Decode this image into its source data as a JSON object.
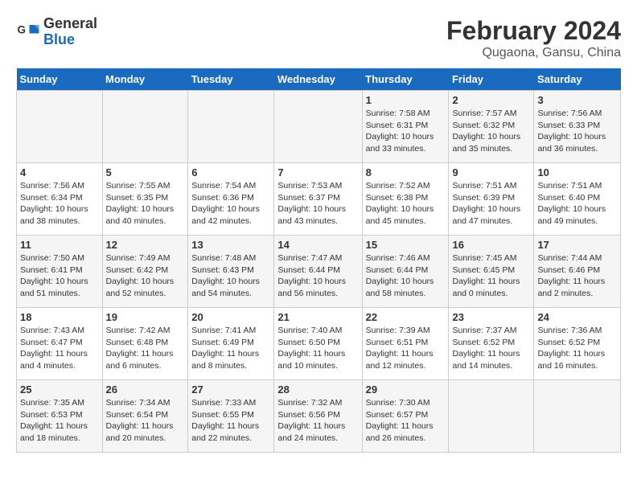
{
  "logo": {
    "text_general": "General",
    "text_blue": "Blue"
  },
  "title": "February 2024",
  "subtitle": "Qugaona, Gansu, China",
  "days_of_week": [
    "Sunday",
    "Monday",
    "Tuesday",
    "Wednesday",
    "Thursday",
    "Friday",
    "Saturday"
  ],
  "weeks": [
    [
      {
        "day": "",
        "info": ""
      },
      {
        "day": "",
        "info": ""
      },
      {
        "day": "",
        "info": ""
      },
      {
        "day": "",
        "info": ""
      },
      {
        "day": "1",
        "info": "Sunrise: 7:58 AM\nSunset: 6:31 PM\nDaylight: 10 hours\nand 33 minutes."
      },
      {
        "day": "2",
        "info": "Sunrise: 7:57 AM\nSunset: 6:32 PM\nDaylight: 10 hours\nand 35 minutes."
      },
      {
        "day": "3",
        "info": "Sunrise: 7:56 AM\nSunset: 6:33 PM\nDaylight: 10 hours\nand 36 minutes."
      }
    ],
    [
      {
        "day": "4",
        "info": "Sunrise: 7:56 AM\nSunset: 6:34 PM\nDaylight: 10 hours\nand 38 minutes."
      },
      {
        "day": "5",
        "info": "Sunrise: 7:55 AM\nSunset: 6:35 PM\nDaylight: 10 hours\nand 40 minutes."
      },
      {
        "day": "6",
        "info": "Sunrise: 7:54 AM\nSunset: 6:36 PM\nDaylight: 10 hours\nand 42 minutes."
      },
      {
        "day": "7",
        "info": "Sunrise: 7:53 AM\nSunset: 6:37 PM\nDaylight: 10 hours\nand 43 minutes."
      },
      {
        "day": "8",
        "info": "Sunrise: 7:52 AM\nSunset: 6:38 PM\nDaylight: 10 hours\nand 45 minutes."
      },
      {
        "day": "9",
        "info": "Sunrise: 7:51 AM\nSunset: 6:39 PM\nDaylight: 10 hours\nand 47 minutes."
      },
      {
        "day": "10",
        "info": "Sunrise: 7:51 AM\nSunset: 6:40 PM\nDaylight: 10 hours\nand 49 minutes."
      }
    ],
    [
      {
        "day": "11",
        "info": "Sunrise: 7:50 AM\nSunset: 6:41 PM\nDaylight: 10 hours\nand 51 minutes."
      },
      {
        "day": "12",
        "info": "Sunrise: 7:49 AM\nSunset: 6:42 PM\nDaylight: 10 hours\nand 52 minutes."
      },
      {
        "day": "13",
        "info": "Sunrise: 7:48 AM\nSunset: 6:43 PM\nDaylight: 10 hours\nand 54 minutes."
      },
      {
        "day": "14",
        "info": "Sunrise: 7:47 AM\nSunset: 6:44 PM\nDaylight: 10 hours\nand 56 minutes."
      },
      {
        "day": "15",
        "info": "Sunrise: 7:46 AM\nSunset: 6:44 PM\nDaylight: 10 hours\nand 58 minutes."
      },
      {
        "day": "16",
        "info": "Sunrise: 7:45 AM\nSunset: 6:45 PM\nDaylight: 11 hours\nand 0 minutes."
      },
      {
        "day": "17",
        "info": "Sunrise: 7:44 AM\nSunset: 6:46 PM\nDaylight: 11 hours\nand 2 minutes."
      }
    ],
    [
      {
        "day": "18",
        "info": "Sunrise: 7:43 AM\nSunset: 6:47 PM\nDaylight: 11 hours\nand 4 minutes."
      },
      {
        "day": "19",
        "info": "Sunrise: 7:42 AM\nSunset: 6:48 PM\nDaylight: 11 hours\nand 6 minutes."
      },
      {
        "day": "20",
        "info": "Sunrise: 7:41 AM\nSunset: 6:49 PM\nDaylight: 11 hours\nand 8 minutes."
      },
      {
        "day": "21",
        "info": "Sunrise: 7:40 AM\nSunset: 6:50 PM\nDaylight: 11 hours\nand 10 minutes."
      },
      {
        "day": "22",
        "info": "Sunrise: 7:39 AM\nSunset: 6:51 PM\nDaylight: 11 hours\nand 12 minutes."
      },
      {
        "day": "23",
        "info": "Sunrise: 7:37 AM\nSunset: 6:52 PM\nDaylight: 11 hours\nand 14 minutes."
      },
      {
        "day": "24",
        "info": "Sunrise: 7:36 AM\nSunset: 6:52 PM\nDaylight: 11 hours\nand 16 minutes."
      }
    ],
    [
      {
        "day": "25",
        "info": "Sunrise: 7:35 AM\nSunset: 6:53 PM\nDaylight: 11 hours\nand 18 minutes."
      },
      {
        "day": "26",
        "info": "Sunrise: 7:34 AM\nSunset: 6:54 PM\nDaylight: 11 hours\nand 20 minutes."
      },
      {
        "day": "27",
        "info": "Sunrise: 7:33 AM\nSunset: 6:55 PM\nDaylight: 11 hours\nand 22 minutes."
      },
      {
        "day": "28",
        "info": "Sunrise: 7:32 AM\nSunset: 6:56 PM\nDaylight: 11 hours\nand 24 minutes."
      },
      {
        "day": "29",
        "info": "Sunrise: 7:30 AM\nSunset: 6:57 PM\nDaylight: 11 hours\nand 26 minutes."
      },
      {
        "day": "",
        "info": ""
      },
      {
        "day": "",
        "info": ""
      }
    ]
  ]
}
